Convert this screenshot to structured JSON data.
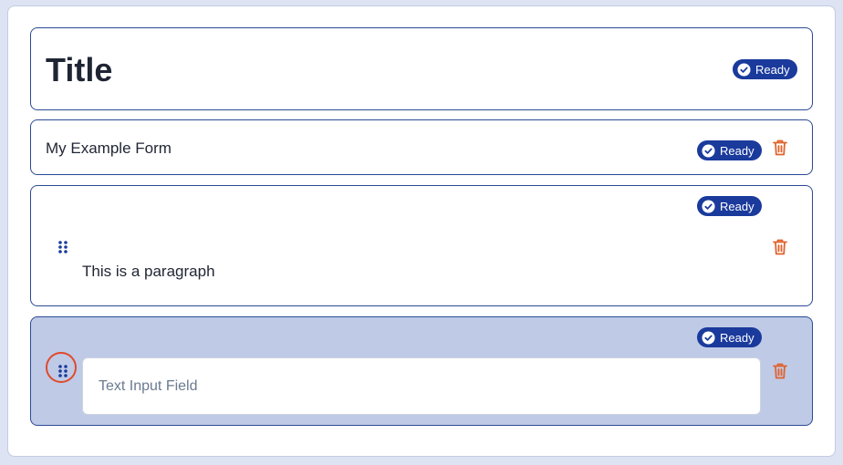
{
  "colors": {
    "badge_bg": "#1a3a9c",
    "card_border": "#2b4a96",
    "selected_bg": "#bfcae6",
    "trash": "#e0622c",
    "grip": "#1a3a9c",
    "focus_ring": "#e04a2c"
  },
  "title_block": {
    "title": "Title",
    "status": "Ready"
  },
  "form_name_block": {
    "text": "My Example Form",
    "status": "Ready",
    "delete_icon": "trash-icon"
  },
  "paragraph_block": {
    "text": "This is a paragraph",
    "status": "Ready",
    "drag_icon": "drag-handle-icon",
    "delete_icon": "trash-icon"
  },
  "text_input_block": {
    "placeholder": "Text Input Field",
    "value": "",
    "status": "Ready",
    "drag_icon": "drag-handle-icon",
    "delete_icon": "trash-icon",
    "selected": true
  }
}
